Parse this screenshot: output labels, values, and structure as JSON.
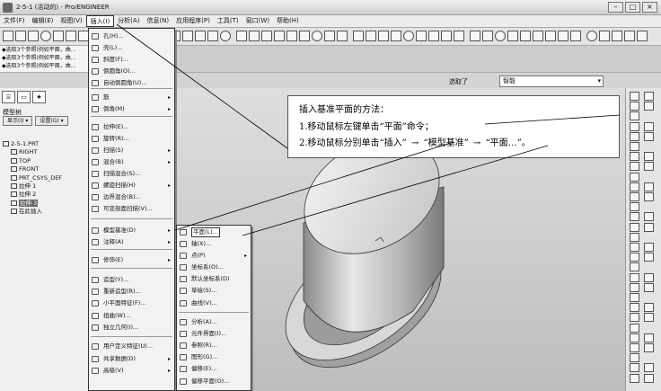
{
  "window": {
    "title": "2-5-1 (活动的) - Pro/ENGINEER"
  },
  "menubar": [
    "文件(F)",
    "编辑(E)",
    "视图(V)",
    "插入(I)",
    "分析(A)",
    "信息(N)",
    "应用程序(P)",
    "工具(T)",
    "窗口(W)",
    "帮助(H)"
  ],
  "menubar_active_index": 3,
  "messages": [
    "◆选取3个参照(例如平面，曲...",
    "◆选取3个参照(例如平面，曲...",
    "◆选取3个参照(例如平面，曲..."
  ],
  "filter": {
    "label": "选取了",
    "value": "智能"
  },
  "left_panel": {
    "title": "模型树",
    "buttons": [
      "显示(I) ▾",
      "设置(G) ▾"
    ],
    "tree": [
      {
        "label": "2-5-1.PRT",
        "indent": 0
      },
      {
        "label": "RIGHT",
        "indent": 1
      },
      {
        "label": "TOP",
        "indent": 1
      },
      {
        "label": "FRONT",
        "indent": 1
      },
      {
        "label": "PRT_CSYS_DEF",
        "indent": 1
      },
      {
        "label": "拉伸 1",
        "indent": 1
      },
      {
        "label": "拉伸 2",
        "indent": 1
      },
      {
        "label": "拉伸 3",
        "indent": 1,
        "selected": true
      },
      {
        "label": "在此插入",
        "indent": 1
      }
    ]
  },
  "insert_menu": {
    "items": [
      {
        "label": "孔(H)...",
        "arrow": false
      },
      {
        "label": "壳(L)...",
        "arrow": false
      },
      {
        "label": "斜度(F)...",
        "arrow": false
      },
      {
        "label": "倒圆角(O)...",
        "arrow": false
      },
      {
        "label": "自动倒圆角(U)...",
        "arrow": false
      },
      {
        "label": "筋",
        "arrow": true
      },
      {
        "label": "倒角(M)",
        "arrow": true
      },
      {
        "label": "拉伸(E)...",
        "arrow": false
      },
      {
        "label": "旋转(R)...",
        "arrow": false
      },
      {
        "label": "扫描(S)",
        "arrow": true
      },
      {
        "label": "混合(B)",
        "arrow": true
      },
      {
        "label": "扫描混合(S)...",
        "arrow": false
      },
      {
        "label": "螺旋扫描(H)",
        "arrow": true
      },
      {
        "label": "边界混合(B)...",
        "arrow": false
      },
      {
        "label": "可变剖面扫描(V)...",
        "arrow": false
      },
      {
        "label": "模型基准(D)",
        "arrow": true
      },
      {
        "label": "注释(A)",
        "arrow": true
      },
      {
        "label": "修饰(E)",
        "arrow": true
      },
      {
        "label": "造型(Y)...",
        "arrow": false
      },
      {
        "label": "重新造型(R)...",
        "arrow": false
      },
      {
        "label": "小平面特征(F)...",
        "arrow": false
      },
      {
        "label": "扭曲(W)...",
        "arrow": false
      },
      {
        "label": "独立几何(I)...",
        "arrow": false
      },
      {
        "label": "用户定义特征(U)...",
        "arrow": false
      },
      {
        "label": "共享数据(D)",
        "arrow": true
      },
      {
        "label": "高级(V)",
        "arrow": true
      }
    ]
  },
  "datum_menu": {
    "items": [
      {
        "label": "平面(L)...",
        "arrow": false,
        "highlight": true
      },
      {
        "label": "轴(X)...",
        "arrow": false
      },
      {
        "label": "点(P)",
        "arrow": true
      },
      {
        "label": "坐标系(O)...",
        "arrow": false
      },
      {
        "label": "默认坐标系(D)",
        "arrow": false
      },
      {
        "label": "草绘(S)...",
        "arrow": false
      },
      {
        "label": "曲线(V)...",
        "arrow": false
      },
      {
        "label": "分析(A)...",
        "arrow": false
      },
      {
        "label": "元件界面(I)...",
        "arrow": false
      },
      {
        "label": "参照(R)...",
        "arrow": false
      },
      {
        "label": "图形(G)...",
        "arrow": false
      },
      {
        "label": "偏移(E)...",
        "arrow": false
      },
      {
        "label": "偏移平面(O)...",
        "arrow": false
      }
    ]
  },
  "annotation": {
    "title": "插入基准平面的方法：",
    "step1": "1.移动鼠标左键单击“平面”命令；",
    "step2_parts": [
      "2.移动鼠标分别单击“插入”",
      "“模型基准”",
      "“平面…”。"
    ]
  },
  "colors": {
    "viewport_top": "#dedede",
    "viewport_bottom": "#bdbdbd",
    "model_light": "#f0f0f0",
    "model_dark": "#9a9a9a"
  }
}
